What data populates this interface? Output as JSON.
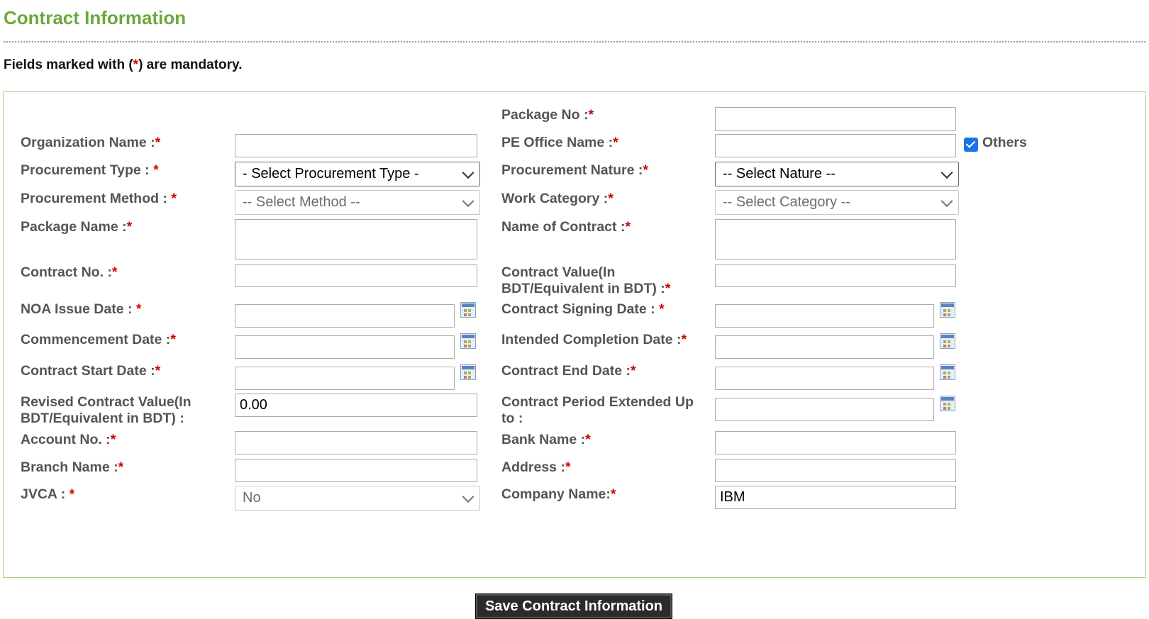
{
  "page": {
    "title": "Contract Information",
    "mandatory_prefix": "Fields marked with (",
    "mandatory_star": "*",
    "mandatory_suffix": ") are mandatory."
  },
  "form": {
    "left": {
      "organization_name": {
        "label": "Organization Name :",
        "value": ""
      },
      "procurement_type": {
        "label": "Procurement Type : ",
        "selected": "- Select Procurement Type -"
      },
      "procurement_method": {
        "label": "Procurement Method : ",
        "selected": "-- Select Method --"
      },
      "package_name": {
        "label": "Package Name :",
        "value": ""
      },
      "contract_no": {
        "label": "Contract No. :",
        "value": ""
      },
      "noa_issue_date": {
        "label": "NOA Issue Date : ",
        "value": ""
      },
      "commencement_date": {
        "label": "Commencement Date :",
        "value": ""
      },
      "contract_start_date": {
        "label": "Contract Start Date :",
        "value": ""
      },
      "revised_contract_value": {
        "label_line1": "Revised Contract Value(In",
        "label_line2": "BDT/Equivalent in BDT) :",
        "value": "0.00"
      },
      "account_no": {
        "label": "Account No. :",
        "value": ""
      },
      "branch_name": {
        "label": "Branch Name :",
        "value": ""
      },
      "jvca": {
        "label": "JVCA : ",
        "selected": "No"
      }
    },
    "right": {
      "package_no": {
        "label": "Package No :",
        "value": ""
      },
      "pe_office_name": {
        "label": "PE Office Name :",
        "value": ""
      },
      "others_checkbox": {
        "label": "Others",
        "checked": true
      },
      "procurement_nature": {
        "label": "Procurement Nature :",
        "selected": "-- Select Nature --"
      },
      "work_category": {
        "label": "Work Category :",
        "selected": "-- Select Category --"
      },
      "name_of_contract": {
        "label": "Name of Contract :",
        "value": ""
      },
      "contract_value": {
        "label_line1": "Contract Value(In",
        "label_line2": "BDT/Equivalent in BDT) :",
        "value": ""
      },
      "contract_signing_date": {
        "label": "Contract Signing Date : ",
        "value": ""
      },
      "intended_completion_date": {
        "label": "Intended Completion Date :",
        "value": ""
      },
      "contract_end_date": {
        "label": "Contract End Date :",
        "value": ""
      },
      "contract_period_extended": {
        "label_line1": "Contract Period Extended Up",
        "label_line2": "to :",
        "value": ""
      },
      "bank_name": {
        "label": "Bank Name :",
        "value": ""
      },
      "address": {
        "label": "Address :",
        "value": ""
      },
      "company_name": {
        "label": "Company Name:",
        "value": "IBM"
      }
    },
    "required_mark": "*"
  },
  "actions": {
    "save_label": "Save Contract Information"
  },
  "colors": {
    "title": "#6aaa3c",
    "required": "#d40000",
    "panel_border": "#a6d38b",
    "button_bg": "#2b2b2b"
  },
  "icons": {
    "calendar": "calendar-icon",
    "dropdown": "chevron-down-icon"
  }
}
